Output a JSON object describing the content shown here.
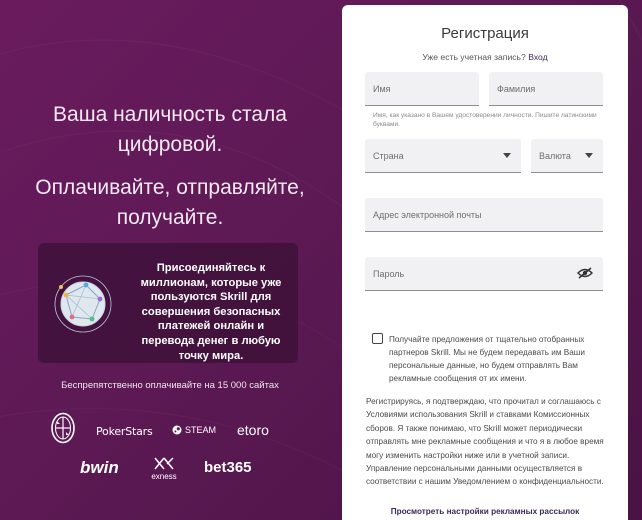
{
  "left": {
    "headline1": "Ваша наличность стала цифровой.",
    "headline2": "Оплачивайте, отправляйте, получайте.",
    "promo_text": "Присоединяйтесь к миллионам, которые уже пользуются Skrill для совершения безопасных платежей онлайн и перевода денег в любую точку мира.",
    "pay_note": "Беспрепятственно оплачивайте на 15 000 сайтах",
    "logos": {
      "pokerstars": "PokerStars",
      "steam": "STEAM",
      "etoro": "etoro",
      "bwin": "bwin",
      "exness": "exness",
      "bet365": "bet365"
    }
  },
  "form": {
    "title": "Регистрация",
    "have_account": "Уже есть учетная запись?",
    "login_link": "Вход",
    "first_name_placeholder": "Имя",
    "last_name_placeholder": "Фамилия",
    "name_hint": "Имя, как указано в Вашем удостоверении личности. Пишите латинскими буквами.",
    "country_placeholder": "Страна",
    "currency_placeholder": "Валюта",
    "email_placeholder": "Адрес электронной почты",
    "password_placeholder": "Пароль",
    "consent_text": "Получайте предложения от тщательно отобранных партнеров Skrill. Мы не будем передавать им Ваши персональные данные, но будем отправлять Вам рекламные сообщения от их имени.",
    "terms_text": "Регистрируясь, я подтверждаю, что прочитал и соглашаюсь с Условиями использования Skrill и ставками Комиссионных сборов. Я также понимаю, что Skrill может периодически отправлять мне рекламные сообщения и что я в любое время могу изменить настройки ниже или в учетной записи. Управление персональными данными осуществляется в соответствии с нашим Уведомлением о конфиденциальности.",
    "ad_settings_link": "Просмотреть настройки рекламных рассылок"
  },
  "colors": {
    "background": "#5e1a55",
    "promo_box": "#3e123a",
    "card": "#ffffff",
    "field": "#f1f1f3",
    "link": "#3b2a56"
  },
  "icons": [
    "globe-network-icon",
    "eye-slash-icon",
    "chevron-down-icon",
    "steam-icon",
    "milan-crest-icon",
    "exness-icon"
  ]
}
